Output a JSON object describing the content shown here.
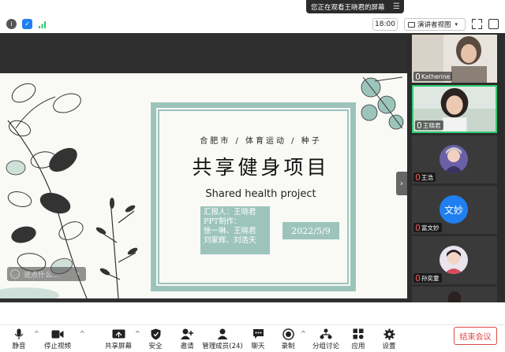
{
  "share_banner": {
    "text": "您正在观看王晓君的屏幕"
  },
  "topbar": {
    "time": "18:00",
    "view_label": "演讲者视图"
  },
  "slide": {
    "subtitle": "合肥市 / 体育运动 / 种子",
    "title": "共享健身项目",
    "english_title": "Shared health project",
    "reporter": [
      "汇报人：王晓君",
      "PPT制作：",
      "徐一琳、王晓君",
      "刘家辉、刘浩天"
    ],
    "date": "2022/5/9"
  },
  "chat_hint": {
    "placeholder": "说点什么..."
  },
  "participants": [
    {
      "name": "Katherine",
      "muted": false,
      "kind": "video"
    },
    {
      "name": "王晓君",
      "muted": false,
      "kind": "video",
      "active": true
    },
    {
      "name": "王浩",
      "muted": true,
      "kind": "avatar"
    },
    {
      "name": "富文妙",
      "muted": true,
      "kind": "text-avatar",
      "avatar_text": "文妙"
    },
    {
      "name": "孙奕童",
      "muted": true,
      "kind": "avatar"
    }
  ],
  "toolbar": {
    "mute": "静音",
    "video": "停止视频",
    "share": "共享屏幕",
    "security": "安全",
    "invite": "邀请",
    "members": "管理成员(24)",
    "chat": "聊天",
    "record": "录制",
    "breakout": "分组讨论",
    "apps": "应用",
    "settings": "设置",
    "end": "结束会议"
  },
  "colors": {
    "accent_teal": "#9cc4bb",
    "active_border": "#2ecc71",
    "end_red": "#e04848"
  }
}
